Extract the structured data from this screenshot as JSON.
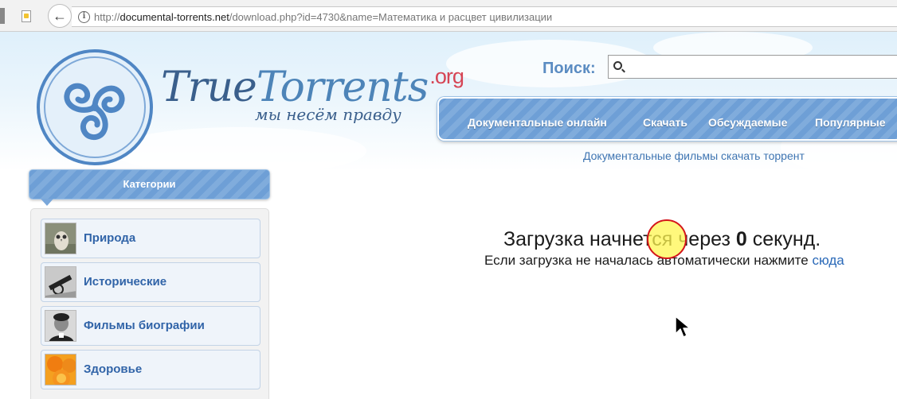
{
  "browser": {
    "url_host": "documental-torrents.net",
    "url_path": "/download.php?id=4730&name=Математика и расцвет цивилизации",
    "url_scheme": "http://",
    "back_glyph": "←",
    "info_glyph": "i"
  },
  "site": {
    "brand_true": "True",
    "brand_torrents": "Torrents",
    "brand_tld": ".org",
    "slogan": "мы несём правду",
    "brand_color": "#3a5f8c",
    "accent_color": "#d64555"
  },
  "search": {
    "label": "Поиск:",
    "value": "",
    "placeholder": ""
  },
  "nav": {
    "items": [
      {
        "label": "Документальные онлайн"
      },
      {
        "label": "Скачать"
      },
      {
        "label": "Обсуждаемые"
      },
      {
        "label": "Популярные"
      }
    ],
    "subtitle": "Документальные фильмы скачать торрент"
  },
  "sidebar": {
    "title": "Категории",
    "items": [
      {
        "label": "Природа",
        "icon": "owl-thumbnail-icon"
      },
      {
        "label": "Исторические",
        "icon": "cannon-thumbnail-icon"
      },
      {
        "label": "Фильмы биографии",
        "icon": "portrait-thumbnail-icon"
      },
      {
        "label": "Здоровье",
        "icon": "oranges-thumbnail-icon"
      }
    ]
  },
  "main": {
    "msg_prefix": "Загрузка начнется через ",
    "countdown": "0",
    "msg_suffix": " секунд.",
    "fallback_text": "Если загрузка не началась автоматически нажмите ",
    "fallback_link": "сюда"
  }
}
